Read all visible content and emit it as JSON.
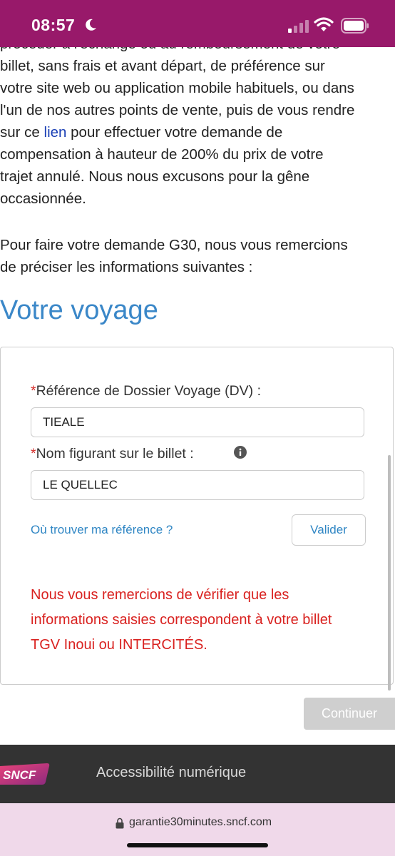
{
  "status_bar": {
    "time": "08:57",
    "background": "#98196a"
  },
  "content": {
    "intro_line0": "procéder à l'échange ou au remboursement de votre",
    "intro_line1": "billet, sans frais et avant départ, de préférence sur",
    "intro_line2": "votre site web ou application mobile habituels, ou dans",
    "intro_line3": "l'un de nos autres points de vente, puis de vous rendre",
    "intro_line4_pre": "sur ce ",
    "intro_link": "lien",
    "intro_line4_post": " pour effectuer votre demande de",
    "intro_line5": "compensation à hauteur de 200% du prix de votre",
    "intro_line6": "trajet annulé. Nous nous excusons pour la gêne",
    "intro_line7": "occasionnée.",
    "para2_line1": "Pour faire votre demande G30, nous vous remercions",
    "para2_line2": "de préciser les informations suivantes :",
    "section_title": "Votre voyage"
  },
  "form": {
    "required_mark": "*",
    "dossier_label": "Référence de Dossier Voyage (DV) :",
    "dossier_value": "TIEALE",
    "name_label": "Nom figurant sur le billet :",
    "name_value": "LE QUELLEC",
    "help_link": "Où trouver ma référence ?",
    "validate_label": "Valider",
    "error_message": "Nous vous remercions de vérifier que les informations saisies correspondent à votre billet TGV Inoui ou INTERCITÉS.",
    "continue_label": "Continuer"
  },
  "footer": {
    "logo_text": "SNCF",
    "accessibility_link": "Accessibilité numérique"
  },
  "browser": {
    "url": "garantie30minutes.sncf.com"
  },
  "colors": {
    "brand": "#98196a",
    "title_blue": "#3a87c8",
    "link_blue": "#2f86c4",
    "error_red": "#d92220"
  }
}
